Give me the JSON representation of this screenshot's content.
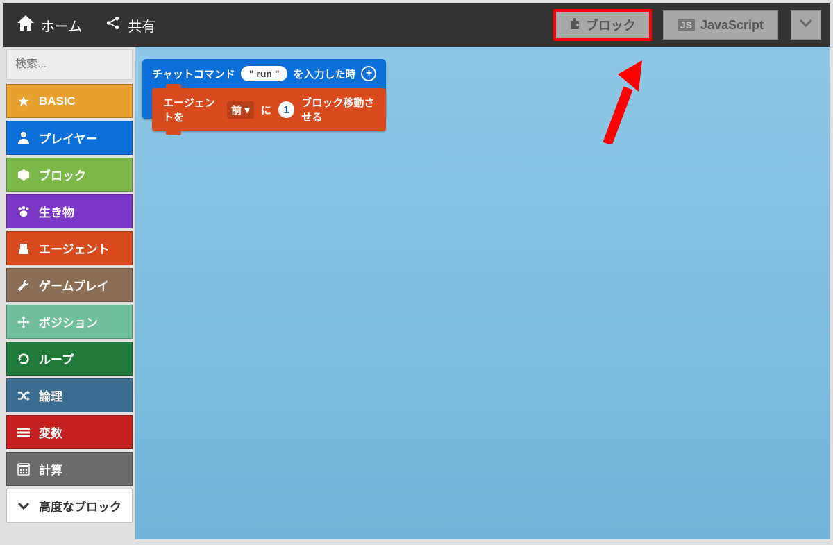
{
  "topbar": {
    "home": "ホーム",
    "share": "共有",
    "blocks_tab": "ブロック",
    "js_tab": "JavaScript",
    "js_badge": "JS"
  },
  "sidebar": {
    "search_placeholder": "検索...",
    "categories": [
      {
        "label": "BASIC"
      },
      {
        "label": "プレイヤー"
      },
      {
        "label": "ブロック"
      },
      {
        "label": "生き物"
      },
      {
        "label": "エージェント"
      },
      {
        "label": "ゲームプレイ"
      },
      {
        "label": "ポジション"
      },
      {
        "label": "ループ"
      },
      {
        "label": "論理"
      },
      {
        "label": "変数"
      },
      {
        "label": "計算"
      },
      {
        "label": "高度なブロック"
      }
    ]
  },
  "blocks": {
    "chat_event_prefix": "チャットコマンド",
    "chat_event_value": "\" run \"",
    "chat_event_suffix": "を入力した時",
    "agent_prefix": "エージェントを",
    "agent_direction": "前",
    "agent_mid": "に",
    "agent_count": "1",
    "agent_suffix": "ブロック移動させる"
  }
}
